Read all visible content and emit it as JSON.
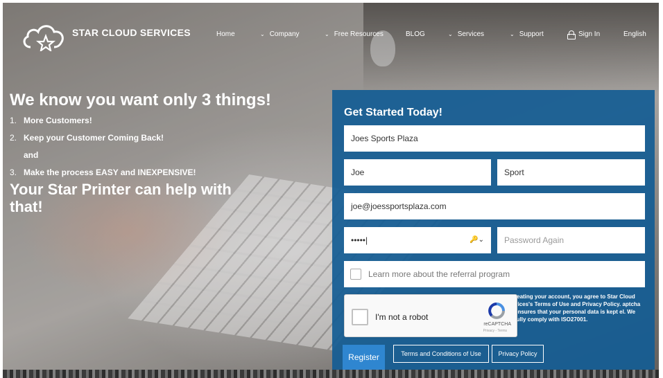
{
  "brand": {
    "name": "STAR CLOUD SERVICES",
    "logo_icon": "cloud-star-icon"
  },
  "nav": {
    "home": "Home",
    "company": "Company",
    "free_resources": "Free Resources",
    "blog": "BLOG",
    "services": "Services",
    "support": "Support",
    "sign_in": "Sign In",
    "language": "English",
    "chevron": "⌄"
  },
  "hero": {
    "headline": "We know you want only 3 things!",
    "items": [
      {
        "num": "1.",
        "text": "More Customers!"
      },
      {
        "num": "2.",
        "text": "Keep your Customer Coming Back!"
      },
      {
        "num": "",
        "text": "and"
      },
      {
        "num": "3.",
        "text": "Make the process EASY and INEXPENSIVE!"
      }
    ],
    "subhead": "Your Star Printer can help with that!"
  },
  "form": {
    "title": "Get Started Today!",
    "company_value": "Joes Sports Plaza",
    "first_name_value": "Joe",
    "last_name_value": "Sport",
    "email_value": "joe@joessportsplaza.com",
    "password_value": "•••••|",
    "password_icon": "🔑⌄",
    "password_again_placeholder": "Password Again",
    "referral_label": "Learn more about the referral program",
    "legal_text": "reating your account, you agree to Star Cloud vices's Terms of Use and Privacy Policy. aptcha ensures that your personal data is kept el. We fully comply with ISO27001.",
    "captcha_label": "I'm not a robot",
    "captcha_brand": "reCAPTCHA",
    "captcha_links": "Privacy - Terms",
    "register_label": "Register",
    "terms_label": "Terms and Conditions of Use",
    "privacy_label": "Privacy Policy"
  },
  "colors": {
    "panel": "#145c94",
    "register": "#2f86d0"
  }
}
